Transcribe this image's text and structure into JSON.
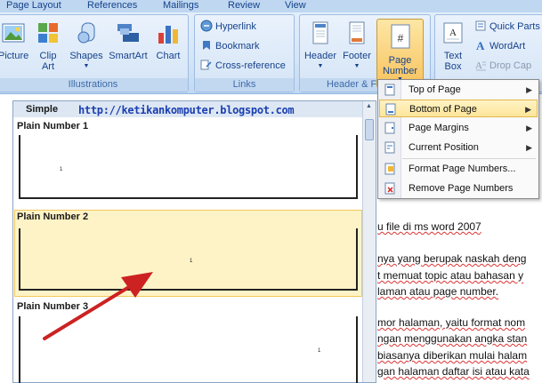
{
  "tabs": [
    "Page Layout",
    "References",
    "Mailings",
    "Review",
    "View"
  ],
  "groups": {
    "illustrations": {
      "label": "Illustrations",
      "buttons": [
        "Picture",
        "Clip\nArt",
        "Shapes",
        "SmartArt",
        "Chart"
      ]
    },
    "links": {
      "label": "Links",
      "buttons": [
        "Hyperlink",
        "Bookmark",
        "Cross-reference"
      ]
    },
    "header_footer": {
      "label": "Header & F",
      "buttons": [
        "Header",
        "Footer"
      ],
      "page_number": "Page\nNumber"
    },
    "text": {
      "text_box": "Text\nBox",
      "quick_parts": "Quick Parts",
      "wordart": "WordArt",
      "drop_cap": "Drop Cap"
    }
  },
  "gallery": {
    "category": "Simple",
    "url": "http://ketikankomputer.blogspot.com",
    "items": [
      {
        "title": "Plain Number 1",
        "number": "1"
      },
      {
        "title": "Plain Number 2",
        "number": "1"
      },
      {
        "title": "Plain Number 3",
        "number": "1"
      }
    ]
  },
  "menu": {
    "items": [
      {
        "label": "Top of Page",
        "submenu": true,
        "icon": "top-of-page-icon"
      },
      {
        "label": "Bottom of Page",
        "submenu": true,
        "icon": "bottom-of-page-icon",
        "highlighted": true
      },
      {
        "label": "Page Margins",
        "submenu": true,
        "icon": "page-margins-icon"
      },
      {
        "label": "Current Position",
        "submenu": true,
        "icon": "current-position-icon"
      },
      {
        "label": "Format Page Numbers...",
        "submenu": false,
        "icon": "format-page-numbers-icon"
      },
      {
        "label": "Remove Page Numbers",
        "submenu": false,
        "icon": "remove-page-numbers-icon"
      }
    ]
  },
  "document": {
    "lines": [
      "u file di ms word 2007",
      "nya yang berupak naskah deng",
      "t memuat topic atau bahasan y",
      "laman atau page number.",
      "mor halaman, yaitu format nom",
      "ngan menggunakan angka stan",
      "biasanya diberikan mulai halam",
      "gan halaman daftar isi atau kata"
    ]
  },
  "colors": {
    "ribbon": "#d5e6f7",
    "highlight": "#fde59a",
    "arrow": "#cc2222",
    "url": "#1b3fb0"
  }
}
